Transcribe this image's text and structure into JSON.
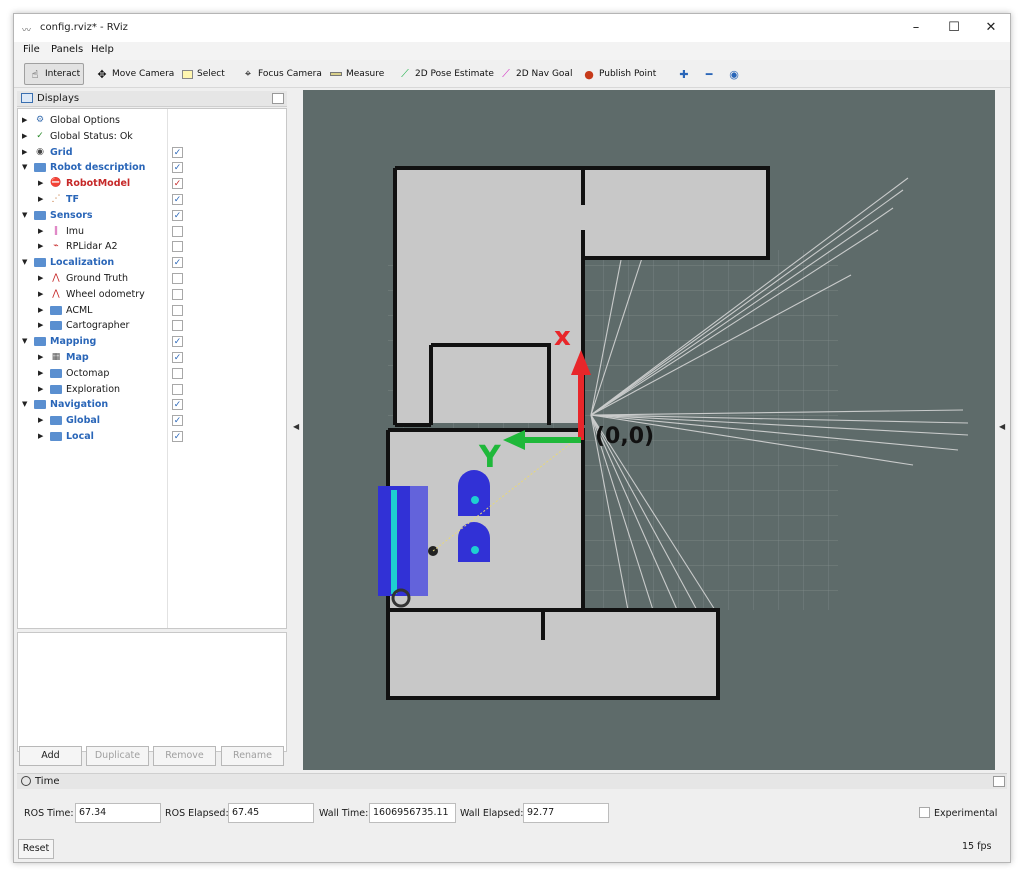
{
  "window": {
    "title": "config.rviz* - RViz",
    "minimize": "–",
    "maximize": "☐",
    "close": "✕"
  },
  "menu": {
    "file": "File",
    "panels": "Panels",
    "help": "Help"
  },
  "toolbar": {
    "interact": "Interact",
    "move_camera": "Move Camera",
    "select": "Select",
    "focus_camera": "Focus Camera",
    "measure": "Measure",
    "pose_estimate": "2D Pose Estimate",
    "nav_goal": "2D Nav Goal",
    "publish_point": "Publish Point"
  },
  "displays": {
    "title": "Displays",
    "items": [
      {
        "label": "Global Options",
        "style": "normal",
        "icon": "gear-icon",
        "checked": null
      },
      {
        "label": "Global Status: Ok",
        "style": "normal",
        "icon": "check-icon",
        "checked": null
      },
      {
        "label": "Grid",
        "style": "group",
        "icon": "eye-icon",
        "checked": true
      },
      {
        "label": "Robot description",
        "style": "group",
        "icon": "folder-icon",
        "checked": true
      },
      {
        "label": "RobotModel",
        "style": "err",
        "icon": "error-icon",
        "checked": true
      },
      {
        "label": "TF",
        "style": "group",
        "icon": "tf-icon",
        "checked": true
      },
      {
        "label": "Sensors",
        "style": "group",
        "icon": "folder-icon",
        "checked": true
      },
      {
        "label": "Imu",
        "style": "normal",
        "icon": "imu-icon",
        "checked": false
      },
      {
        "label": "RPLidar A2",
        "style": "normal",
        "icon": "laser-icon",
        "checked": false
      },
      {
        "label": "Localization",
        "style": "group",
        "icon": "folder-icon",
        "checked": true
      },
      {
        "label": "Ground Truth",
        "style": "normal",
        "icon": "odometry-icon",
        "checked": false
      },
      {
        "label": "Wheel odometry",
        "style": "normal",
        "icon": "odometry-icon",
        "checked": false
      },
      {
        "label": "ACML",
        "style": "normal",
        "icon": "folder-icon",
        "checked": false
      },
      {
        "label": "Cartographer",
        "style": "normal",
        "icon": "folder-icon",
        "checked": false
      },
      {
        "label": "Mapping",
        "style": "group",
        "icon": "folder-icon",
        "checked": true
      },
      {
        "label": "Map",
        "style": "group",
        "icon": "map-icon",
        "checked": true
      },
      {
        "label": "Octomap",
        "style": "normal",
        "icon": "folder-icon",
        "checked": false
      },
      {
        "label": "Exploration",
        "style": "normal",
        "icon": "folder-icon",
        "checked": false
      },
      {
        "label": "Navigation",
        "style": "group",
        "icon": "folder-icon",
        "checked": true
      },
      {
        "label": "Global",
        "style": "group",
        "icon": "folder-icon",
        "checked": true
      },
      {
        "label": "Local",
        "style": "group",
        "icon": "folder-icon",
        "checked": true
      }
    ],
    "buttons": {
      "add": "Add",
      "duplicate": "Duplicate",
      "remove": "Remove",
      "rename": "Rename"
    }
  },
  "viewport": {
    "x_axis_label": "x",
    "y_axis_label": "Y",
    "origin_label": "(0,0)",
    "colors": {
      "background": "#5e6b6a",
      "free_space": "#c8c8c8",
      "wall": "#111111",
      "x_axis": "#e8262a",
      "y_axis": "#1fb83a"
    }
  },
  "time": {
    "title": "Time",
    "ros_time_label": "ROS Time:",
    "ros_time": "67.34",
    "ros_elapsed_label": "ROS Elapsed:",
    "ros_elapsed": "67.45",
    "wall_time_label": "Wall Time:",
    "wall_time": "1606956735.11",
    "wall_elapsed_label": "Wall Elapsed:",
    "wall_elapsed": "92.77",
    "experimental": "Experimental",
    "reset": "Reset",
    "fps": "15 fps"
  }
}
